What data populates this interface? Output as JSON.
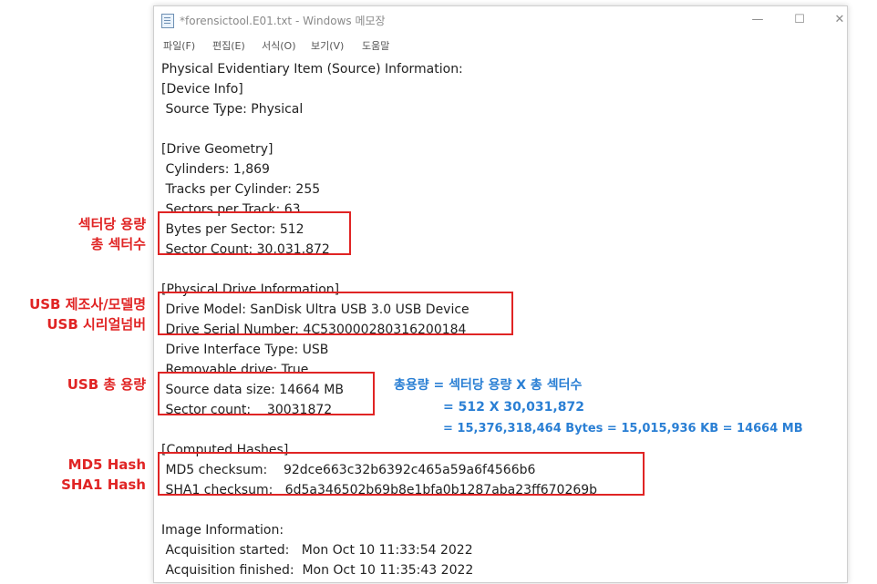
{
  "window": {
    "title": "*forensictool.E01.txt - Windows 메모장",
    "controls": {
      "minimize": "—",
      "maximize": "☐",
      "close": "✕"
    }
  },
  "menu": [
    "파일(F)",
    "편집(E)",
    "서식(O)",
    "보기(V)",
    "도움말"
  ],
  "lines": [
    "Physical Evidentiary Item (Source) Information:",
    "[Device Info]",
    " Source Type: Physical",
    "",
    "[Drive Geometry]",
    " Cylinders: 1,869",
    " Tracks per Cylinder: 255",
    " Sectors per Track: 63",
    " Bytes per Sector: 512",
    " Sector Count: 30,031,872",
    "",
    "[Physical Drive Information]",
    " Drive Model: SanDisk Ultra USB 3.0 USB Device",
    " Drive Serial Number: 4C530000280316200184",
    " Drive Interface Type: USB",
    " Removable drive: True",
    " Source data size: 14664 MB",
    " Sector count:    30031872",
    "",
    "[Computed Hashes]",
    " MD5 checksum:    92dce663c32b6392c465a59a6f4566b6",
    " SHA1 checksum:   6d5a346502b69b8e1bfa0b1287aba23ff670269b",
    "",
    "Image Information:",
    " Acquisition started:   Mon Oct 10 11:33:54 2022",
    " Acquisition finished:  Mon Oct 10 11:35:43 2022"
  ],
  "annotations": {
    "bytes_per_sector": "섹터당 용량",
    "sector_count": "총 섹터수",
    "usb_maker": "USB 제조사/모델명",
    "usb_serial": "USB 시리얼넘버",
    "usb_size": "USB 총 용량",
    "md5": "MD5 Hash",
    "sha1": "SHA1 Hash"
  },
  "formula": [
    "총용량 = 섹터당 용량 X 총 섹터수",
    "= 512 X 30,031,872",
    "= 15,376,318,464 Bytes = 15,015,936 KB = 14664 MB"
  ],
  "colors": {
    "highlight": "#e02424",
    "formula": "#2a7fd4"
  }
}
